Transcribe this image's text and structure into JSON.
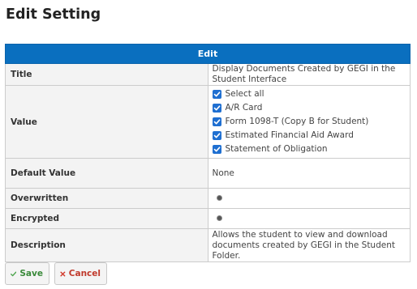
{
  "page": {
    "title": "Edit Setting"
  },
  "table": {
    "header": "Edit",
    "rows": {
      "title": {
        "label": "Title",
        "value": "Display Documents Created by GEGI in the Student Interface"
      },
      "value": {
        "label": "Value",
        "options": [
          {
            "label": "Select all",
            "checked": true
          },
          {
            "label": "A/R Card",
            "checked": true
          },
          {
            "label": "Form 1098-T (Copy B for Student)",
            "checked": true
          },
          {
            "label": "Estimated Financial Aid Award",
            "checked": true
          },
          {
            "label": "Statement of Obligation",
            "checked": true
          }
        ]
      },
      "default": {
        "label": "Default Value",
        "value": "None"
      },
      "overwritten": {
        "label": "Overwritten"
      },
      "encrypted": {
        "label": "Encrypted"
      },
      "description": {
        "label": "Description",
        "value": "Allows the student to view and download documents created by GEGI in the Student Folder."
      }
    }
  },
  "buttons": {
    "save": "Save",
    "cancel": "Cancel"
  },
  "colors": {
    "header_bg": "#0a6fbf",
    "checkbox": "#1f6fd1",
    "save": "#3a8a3a",
    "cancel": "#c0392b"
  }
}
